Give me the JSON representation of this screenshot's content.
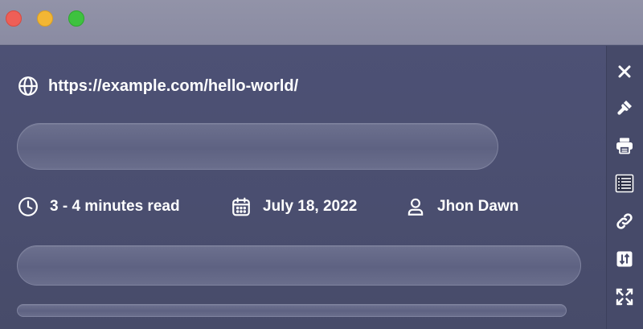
{
  "page": {
    "url": "https://example.com/hello-world/"
  },
  "meta": {
    "read_time": "3 - 4 minutes read",
    "date": "July 18, 2022",
    "author": "Jhon Dawn"
  },
  "sidebar": {
    "tools": [
      {
        "icon": "close-icon"
      },
      {
        "icon": "brush-icon"
      },
      {
        "icon": "printer-icon"
      },
      {
        "icon": "list-icon"
      },
      {
        "icon": "link-icon"
      },
      {
        "icon": "sort-icon"
      },
      {
        "icon": "expand-icon"
      }
    ]
  },
  "colors": {
    "background": "#4a4f6e",
    "titlebar": "#8a8ba2",
    "traffic_red": "#ee5f57",
    "traffic_yellow": "#f2b634",
    "traffic_green": "#3ec23f",
    "text": "#ffffff"
  }
}
